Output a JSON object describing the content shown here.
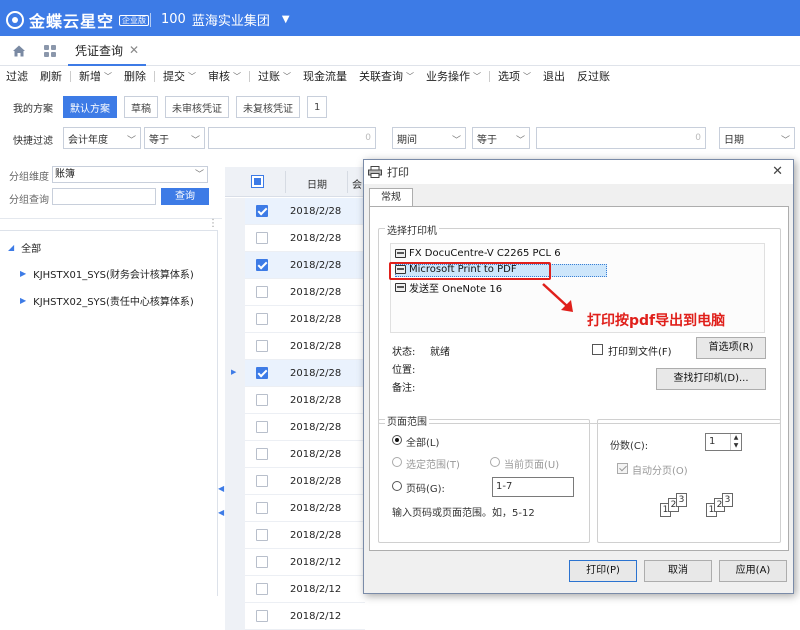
{
  "app": {
    "logo": "金蝶云星空",
    "edition": "企业版",
    "org_code": "100",
    "org_name": "蓝海实业集团"
  },
  "tabs": [
    {
      "label": "凭证查询"
    }
  ],
  "toolbar": [
    "过滤",
    "刷新",
    "新增",
    "删除",
    "提交",
    "审核",
    "过账",
    "现金流量",
    "关联查询",
    "业务操作",
    "选项",
    "退出",
    "反过账"
  ],
  "plans": {
    "label": "我的方案",
    "items": [
      "默认方案",
      "草稿",
      "未审核凭证",
      "未复核凭证",
      "1"
    ]
  },
  "quick_filter": {
    "label": "快捷过滤",
    "field1": "会计年度",
    "op1": "等于",
    "value1_hint": "0",
    "field2": "期间",
    "op2": "等于",
    "value2_hint": "0",
    "field3": "日期"
  },
  "left": {
    "group_dim_label": "分组维度",
    "group_dim_value": "账簿",
    "group_query_label": "分组查询",
    "query_btn": "查询",
    "tree": {
      "root": "全部",
      "children": [
        "KJHSTX01_SYS(财务会计核算体系)",
        "KJHSTX02_SYS(责任中心核算体系)"
      ]
    }
  },
  "grid": {
    "col_date": "日期",
    "col_extra": "会",
    "rows": [
      {
        "date": "2018/2/28",
        "checked": true
      },
      {
        "date": "2018/2/28",
        "checked": false
      },
      {
        "date": "2018/2/28",
        "checked": true
      },
      {
        "date": "2018/2/28",
        "checked": false
      },
      {
        "date": "2018/2/28",
        "checked": false
      },
      {
        "date": "2018/2/28",
        "checked": false
      },
      {
        "date": "2018/2/28",
        "checked": true
      },
      {
        "date": "2018/2/28",
        "checked": false
      },
      {
        "date": "2018/2/28",
        "checked": false
      },
      {
        "date": "2018/2/28",
        "checked": false
      },
      {
        "date": "2018/2/28",
        "checked": false
      },
      {
        "date": "2018/2/28",
        "checked": false
      },
      {
        "date": "2018/2/28",
        "checked": false
      },
      {
        "date": "2018/2/12",
        "checked": false
      },
      {
        "date": "2018/2/12",
        "checked": false
      },
      {
        "date": "2018/2/12",
        "checked": false
      }
    ]
  },
  "dialog": {
    "title": "打印",
    "tab": "常规",
    "printer_group": "选择打印机",
    "printers": [
      "FX DocuCentre-V C2265 PCL 6",
      "Microsoft Print to PDF",
      "发送至 OneNote 16"
    ],
    "selected_printer": "Microsoft Print to PDF",
    "annotation": "打印按pdf导出到电脑",
    "status_label": "状态:",
    "status_value": "就绪",
    "location_label": "位置:",
    "comment_label": "备注:",
    "print_to_file": "打印到文件(F)",
    "preferences": "首选项(R)",
    "find_printer": "查找打印机(D)...",
    "range_group": "页面范围",
    "range_all": "全部(L)",
    "range_selection": "选定范围(T)",
    "range_current": "当前页面(U)",
    "range_pages": "页码(G):",
    "pages_value": "1-7",
    "range_hint": "输入页码或页面范围。如，5-12",
    "copies_label": "份数(C):",
    "copies_value": "1",
    "collate": "自动分页(O)",
    "print_btn": "打印(P)",
    "cancel_btn": "取消",
    "apply_btn": "应用(A)"
  },
  "colors": {
    "brand": "#3d7be6",
    "annotation": "#e0201b"
  }
}
